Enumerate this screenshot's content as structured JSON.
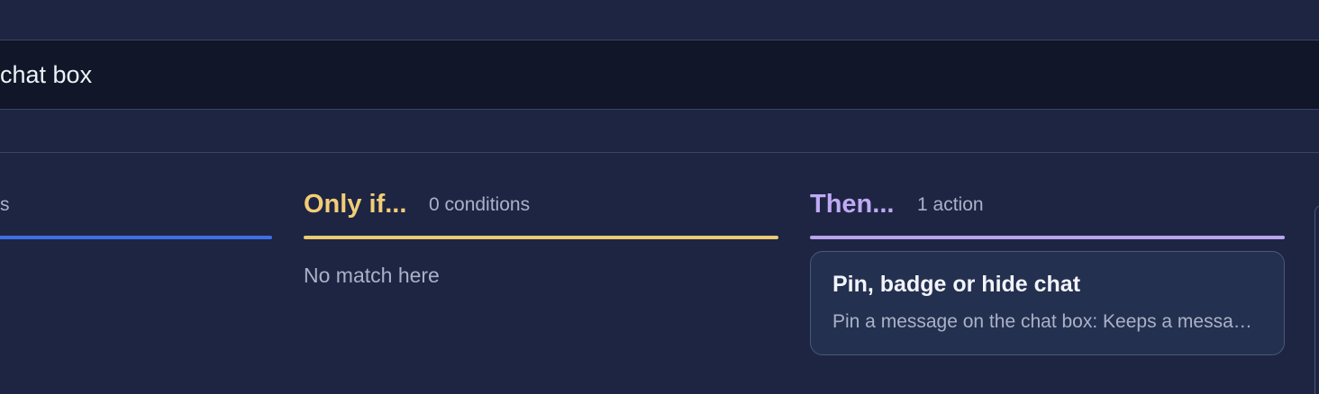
{
  "search": {
    "value": "chat box"
  },
  "columns": {
    "triggers": {
      "count_label": "s"
    },
    "conditions": {
      "title": "Only if...",
      "count_label": "0 conditions",
      "empty_message": "No match here"
    },
    "actions": {
      "title": "Then...",
      "count_label": "1 action",
      "cards": [
        {
          "title": "Pin, badge or hide chat",
          "description": "Pin a message on the chat box: Keeps a message pinned at the top of the chat box"
        }
      ]
    }
  },
  "colors": {
    "background": "#1d2543",
    "search_background": "#111628",
    "trigger_accent": "#3f6fe6",
    "condition_accent": "#ecc973",
    "action_accent": "#b9a5ee",
    "card_background": "#24304f"
  }
}
